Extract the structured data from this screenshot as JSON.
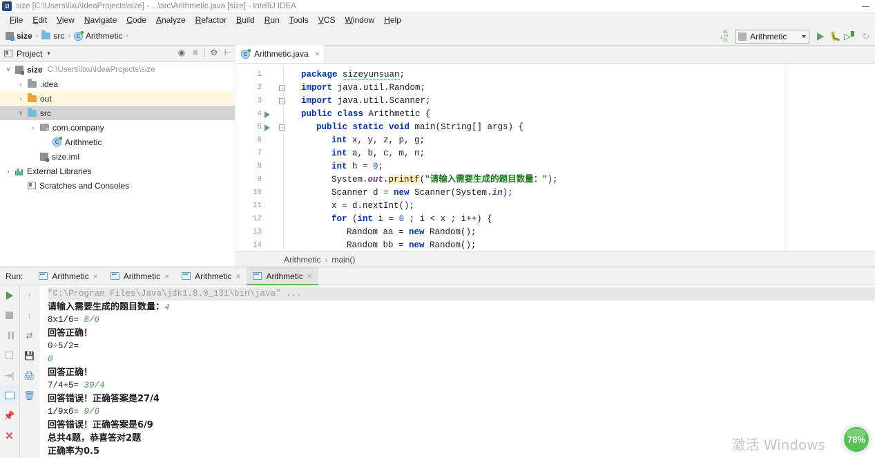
{
  "window": {
    "title": "size [C:\\Users\\lixu\\IdeaProjects\\size] - ...\\src\\Arithmetic.java [size] - IntelliJ IDEA",
    "logo": "IJ",
    "minimize_label": "—"
  },
  "menubar": {
    "items": [
      {
        "label": "File"
      },
      {
        "label": "Edit"
      },
      {
        "label": "View"
      },
      {
        "label": "Navigate"
      },
      {
        "label": "Code"
      },
      {
        "label": "Analyze"
      },
      {
        "label": "Refactor"
      },
      {
        "label": "Build"
      },
      {
        "label": "Run"
      },
      {
        "label": "Tools"
      },
      {
        "label": "VCS"
      },
      {
        "label": "Window"
      },
      {
        "label": "Help"
      }
    ]
  },
  "navbar": {
    "breadcrumb": [
      {
        "label": "size",
        "icon": "module-icon"
      },
      {
        "label": "src",
        "icon": "folder-icon"
      },
      {
        "label": "Arithmetic",
        "icon": "java-class-icon"
      }
    ],
    "separator": "›",
    "run_config": "Arithmetic",
    "icons": {
      "download": "download-updates-icon",
      "run": "run-icon",
      "debug": "debug-icon",
      "coverage": "run-with-coverage-icon",
      "more": "more-icon"
    }
  },
  "project_panel": {
    "title": "Project",
    "dropdown": "▾",
    "toolbar_icons": [
      "locate-icon",
      "collapse-all-icon",
      "settings-gear-icon",
      "hide-icon"
    ],
    "tree": [
      {
        "label": "size",
        "path": "C:\\Users\\lixu\\IdeaProjects\\size",
        "icon": "module-icon",
        "arrow": "∨",
        "indent": 0,
        "bold": true,
        "state": "none"
      },
      {
        "label": ".idea",
        "path": "",
        "icon": "folder-gray-icon",
        "arrow": "›",
        "indent": 1,
        "bold": false,
        "state": "none"
      },
      {
        "label": "out",
        "path": "",
        "icon": "folder-orange-icon",
        "arrow": "›",
        "indent": 1,
        "bold": false,
        "state": "yellow"
      },
      {
        "label": "src",
        "path": "",
        "icon": "folder-blue-icon",
        "arrow": "∨",
        "indent": 1,
        "bold": false,
        "state": "gray"
      },
      {
        "label": "com.company",
        "path": "",
        "icon": "package-icon",
        "arrow": "›",
        "indent": 2,
        "bold": false,
        "state": "none"
      },
      {
        "label": "Arithmetic",
        "path": "",
        "icon": "java-class-icon",
        "arrow": "",
        "indent": 3,
        "bold": false,
        "state": "none"
      },
      {
        "label": "size.iml",
        "path": "",
        "icon": "iml-file-icon",
        "arrow": "",
        "indent": 2,
        "bold": false,
        "state": "none"
      },
      {
        "label": "External Libraries",
        "path": "",
        "icon": "library-icon",
        "arrow": "›",
        "indent": 0,
        "bold": false,
        "state": "none"
      },
      {
        "label": "Scratches and Consoles",
        "path": "",
        "icon": "scratches-icon",
        "arrow": "",
        "indent": 1,
        "bold": false,
        "state": "none"
      }
    ]
  },
  "editor": {
    "tab": {
      "label": "Arithmetic.java",
      "icon": "java-class-icon",
      "close": "×"
    },
    "breadcrumb": {
      "class": "Arithmetic",
      "method": "main()",
      "separator": "›"
    },
    "lines": [
      {
        "n": "1",
        "runmark": false,
        "fold": "",
        "indent": 0,
        "tokens": [
          {
            "t": "package ",
            "c": "kw"
          },
          {
            "t": "sizeyunsuan",
            "c": "sq"
          },
          {
            "t": ";",
            "c": ""
          }
        ]
      },
      {
        "n": "2",
        "runmark": false,
        "fold": "-",
        "indent": 0,
        "tokens": [
          {
            "t": "import ",
            "c": "kw"
          },
          {
            "t": "java.util.Random;",
            "c": ""
          }
        ]
      },
      {
        "n": "3",
        "runmark": false,
        "fold": "-",
        "indent": 0,
        "tokens": [
          {
            "t": "import ",
            "c": "kw"
          },
          {
            "t": "java.util.Scanner;",
            "c": ""
          }
        ]
      },
      {
        "n": "4",
        "runmark": true,
        "fold": "",
        "indent": 0,
        "tokens": [
          {
            "t": "public class ",
            "c": "kw"
          },
          {
            "t": "Arithmetic {",
            "c": ""
          }
        ]
      },
      {
        "n": "5",
        "runmark": true,
        "fold": "-",
        "indent": 1,
        "tokens": [
          {
            "t": "public static void ",
            "c": "kw"
          },
          {
            "t": "main(String[] args) {",
            "c": ""
          }
        ]
      },
      {
        "n": "6",
        "runmark": false,
        "fold": "",
        "indent": 2,
        "tokens": [
          {
            "t": "int ",
            "c": "kw"
          },
          {
            "t": "x, y, z, p, g;",
            "c": ""
          }
        ]
      },
      {
        "n": "7",
        "runmark": false,
        "fold": "",
        "indent": 2,
        "tokens": [
          {
            "t": "int ",
            "c": "kw"
          },
          {
            "t": "a, b, c, m, n;",
            "c": ""
          }
        ]
      },
      {
        "n": "8",
        "runmark": false,
        "fold": "",
        "indent": 2,
        "tokens": [
          {
            "t": "int ",
            "c": "kw"
          },
          {
            "t": "h = ",
            "c": ""
          },
          {
            "t": "0",
            "c": "num"
          },
          {
            "t": ";",
            "c": ""
          }
        ]
      },
      {
        "n": "9",
        "runmark": false,
        "fold": "",
        "indent": 2,
        "tokens": [
          {
            "t": "System.",
            "c": ""
          },
          {
            "t": "out",
            "c": "fld"
          },
          {
            "t": ".",
            "c": ""
          },
          {
            "t": "printf",
            "c": "hl"
          },
          {
            "t": "(",
            "c": ""
          },
          {
            "t": "\"请输入需要生成的题目数量：\"",
            "c": "str"
          },
          {
            "t": ");",
            "c": ""
          }
        ]
      },
      {
        "n": "10",
        "runmark": false,
        "fold": "",
        "indent": 2,
        "tokens": [
          {
            "t": "Scanner d = ",
            "c": ""
          },
          {
            "t": "new ",
            "c": "kw"
          },
          {
            "t": "Scanner(System.",
            "c": ""
          },
          {
            "t": "in",
            "c": "fld"
          },
          {
            "t": ");",
            "c": ""
          }
        ]
      },
      {
        "n": "11",
        "runmark": false,
        "fold": "",
        "indent": 2,
        "tokens": [
          {
            "t": "x = d.nextInt();",
            "c": ""
          }
        ]
      },
      {
        "n": "12",
        "runmark": false,
        "fold": "",
        "indent": 2,
        "tokens": [
          {
            "t": "for ",
            "c": "kw"
          },
          {
            "t": "(",
            "c": ""
          },
          {
            "t": "int ",
            "c": "kw"
          },
          {
            "t": "i = ",
            "c": ""
          },
          {
            "t": "0",
            "c": "num"
          },
          {
            "t": " ; i < x ; i++) {",
            "c": ""
          }
        ]
      },
      {
        "n": "13",
        "runmark": false,
        "fold": "",
        "indent": 3,
        "tokens": [
          {
            "t": "Random aa = ",
            "c": ""
          },
          {
            "t": "new ",
            "c": "kw"
          },
          {
            "t": "Random();",
            "c": ""
          }
        ]
      },
      {
        "n": "14",
        "runmark": false,
        "fold": "",
        "indent": 3,
        "tokens": [
          {
            "t": "Random bb = ",
            "c": ""
          },
          {
            "t": "new ",
            "c": "kw"
          },
          {
            "t": "Random();",
            "c": ""
          }
        ]
      }
    ]
  },
  "run_panel": {
    "label": "Run:",
    "tabs": [
      {
        "label": "Arithmetic",
        "active": false,
        "close": "×"
      },
      {
        "label": "Arithmetic",
        "active": false,
        "close": "×"
      },
      {
        "label": "Arithmetic",
        "active": false,
        "close": "×"
      },
      {
        "label": "Arithmetic",
        "active": true,
        "close": "×"
      }
    ],
    "sidebar_icons": [
      "rerun-icon",
      "stop-icon",
      "pause-icon",
      "print-icon",
      "export-icon",
      "wrap-text-icon",
      "pin-icon",
      "close-icon"
    ],
    "sidebar2_icons": [
      "scroll-up-icon",
      "scroll-down-icon",
      "soft-wrap-icon",
      "save-output-icon",
      "print-output-icon",
      "clear-all-icon"
    ],
    "console": [
      {
        "text": "\"C:\\Program Files\\Java\\jdk1.8.0_131\\bin\\java\" ...",
        "style": "mono-dim",
        "selected": true
      },
      {
        "text": "请输入需要生成的题目数量：4",
        "style": "cjk",
        "answer": "4"
      },
      {
        "text": "8x1/6= 8/6",
        "style": "mono",
        "green_from": 7
      },
      {
        "text": "回答正确！",
        "style": "cjk"
      },
      {
        "text": "0÷5/2=",
        "style": "mono"
      },
      {
        "text": "0",
        "style": "mono-green"
      },
      {
        "text": "回答正确！",
        "style": "cjk"
      },
      {
        "text": "7/4+5= 39/4",
        "style": "mono",
        "green_from": 7
      },
      {
        "text": "回答错误！正确答案是27/4",
        "style": "cjk"
      },
      {
        "text": "1/9x6= 9/6",
        "style": "mono",
        "green_from": 7
      },
      {
        "text": "回答错误！正确答案是6/9",
        "style": "cjk"
      },
      {
        "text": "总共4题，恭喜答对2题",
        "style": "cjk"
      },
      {
        "text": "正确率为0.5",
        "style": "cjk"
      }
    ]
  },
  "overlays": {
    "watermark": "激活 Windows",
    "percent_badge": "78%"
  },
  "colors": {
    "accent_green": "#59a869",
    "keyword_blue": "#0033b3",
    "string_green": "#1a7a1a",
    "console_green": "#4e9a4e",
    "highlight_yellow": "#fdf1c4",
    "selected_row": "#d4d4d4",
    "yellow_row": "#fff8e1"
  }
}
